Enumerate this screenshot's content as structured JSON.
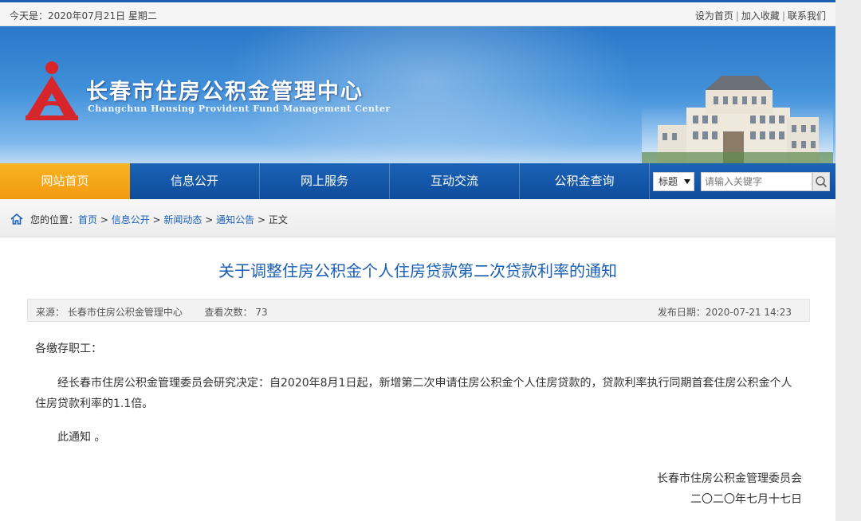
{
  "topbar": {
    "date": "今天是：2020年07月21日 星期二",
    "links": [
      "设为首页",
      "加入收藏",
      "联系我们"
    ],
    "separator": "|"
  },
  "banner": {
    "title_cn": "长春市住房公积金管理中心",
    "title_en": "Changchun Housing Provident Fund Management Center",
    "logo_icon": "provident-fund-logo-icon",
    "colors": {
      "banner_top": "#2a78c9",
      "logo_red": "#d7262b"
    }
  },
  "nav": {
    "items": [
      {
        "label": "网站首页",
        "active": true
      },
      {
        "label": "信息公开",
        "active": false
      },
      {
        "label": "网上服务",
        "active": false
      },
      {
        "label": "互动交流",
        "active": false
      },
      {
        "label": "公积金查询",
        "active": false
      }
    ],
    "search_type": "标题",
    "search_placeholder": "请输入关键字",
    "colors": {
      "nav_bg": "#0e4c9c",
      "active_bg": "#f29a12"
    }
  },
  "breadcrumb": {
    "prefix": "您的位置：",
    "items": [
      "首页",
      "信息公开",
      "新闻动态",
      "通知公告"
    ],
    "separator": " > ",
    "current": "正文"
  },
  "article": {
    "title": "关于调整住房公积金个人住房贷款第二次贷款利率的通知",
    "source_label": "来源：",
    "source": "长春市住房公积金管理中心",
    "views_label": "查看次数：",
    "views": "73",
    "date_label": "发布日期：",
    "date": "2020-07-21 14:23",
    "greeting": "各缴存职工：",
    "paragraph": "经长春市住房公积金管理委员会研究决定：自2020年8月1日起，新增第二次申请住房公积金个人住房贷款的，贷款利率执行同期首套住房公积金个人住房贷款利率的1.1倍。",
    "notice": "此通知 。",
    "signer": "长春市住房公积金管理委员会",
    "sign_date": "二〇二〇年七月十七日",
    "title_color": "#1a5fb4"
  }
}
